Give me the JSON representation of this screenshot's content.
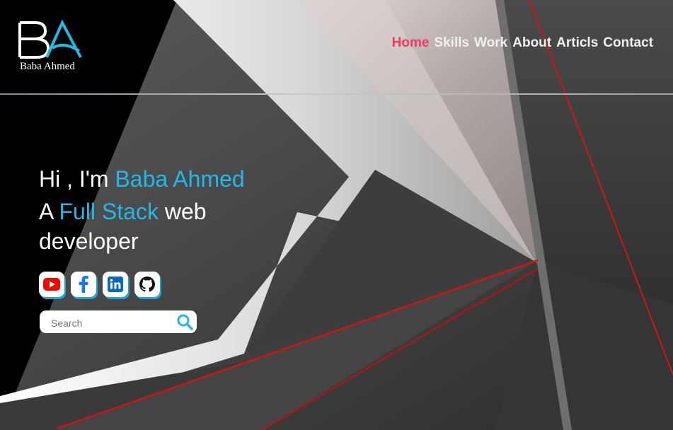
{
  "brand": {
    "logo_letters": "BA",
    "name": "Baba Ahmed"
  },
  "nav": {
    "items": [
      {
        "label": "Home",
        "active": true
      },
      {
        "label": "Skills",
        "active": false
      },
      {
        "label": "Work",
        "active": false
      },
      {
        "label": "About",
        "active": false
      },
      {
        "label": "Articls",
        "active": false
      },
      {
        "label": "Contact",
        "active": false
      }
    ]
  },
  "hero": {
    "greeting": "Hi , I'm ",
    "name": "Baba Ahmed",
    "role_prefix": "A ",
    "role_highlight": "Full Stack",
    "role_suffix": " web developer"
  },
  "social": [
    {
      "icon": "youtube-icon",
      "color": "#ff0000"
    },
    {
      "icon": "facebook-icon",
      "color": "#1877f2"
    },
    {
      "icon": "linkedin-icon",
      "color": "#0a66c2"
    },
    {
      "icon": "github-icon",
      "color": "#111111"
    }
  ],
  "search": {
    "placeholder": "Search",
    "value": ""
  },
  "colors": {
    "accent": "#22b8e8",
    "active_nav": "#f03a5f",
    "background": "#000000"
  }
}
